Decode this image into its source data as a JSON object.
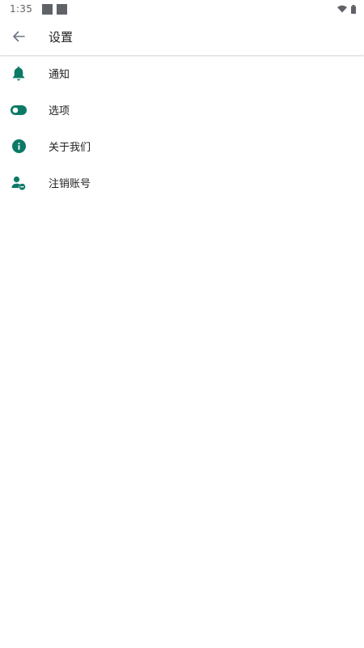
{
  "status_bar": {
    "time": "1:35",
    "icons": [
      "notification-square-icon",
      "notification-square-icon",
      "wifi-icon",
      "battery-icon"
    ]
  },
  "app_bar": {
    "title": "设置",
    "back_icon": "arrow-back-icon"
  },
  "settings": {
    "items": [
      {
        "label": "通知",
        "icon": "bell-icon"
      },
      {
        "label": "选项",
        "icon": "toggle-icon"
      },
      {
        "label": "关于我们",
        "icon": "info-icon"
      },
      {
        "label": "注销账号",
        "icon": "person-remove-icon"
      }
    ]
  },
  "colors": {
    "accent": "#0b7a66",
    "status_icons": "#5f6368",
    "back_arrow": "#6b7280"
  }
}
